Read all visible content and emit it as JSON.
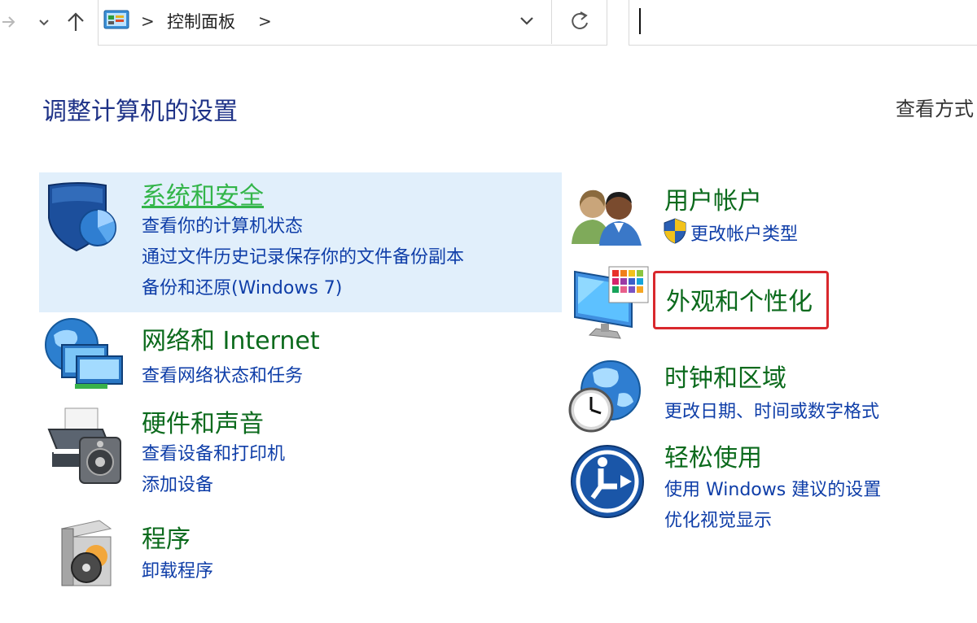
{
  "addressbar": {
    "crumb": "控制面板",
    "sep1": ">",
    "sep2": ">"
  },
  "search": {
    "value": "",
    "placeholder": ""
  },
  "page": {
    "title": "调整计算机的设置",
    "view_by": "查看方式"
  },
  "categories": {
    "system_security": {
      "title": "系统和安全",
      "links": [
        "查看你的计算机状态",
        "通过文件历史记录保存你的文件备份副本",
        "备份和还原(Windows 7)"
      ]
    },
    "network": {
      "title": "网络和 Internet",
      "links": [
        "查看网络状态和任务"
      ]
    },
    "hardware": {
      "title": "硬件和声音",
      "links": [
        "查看设备和打印机",
        "添加设备"
      ]
    },
    "programs": {
      "title": "程序",
      "links": [
        "卸载程序"
      ]
    },
    "user_accounts": {
      "title": "用户帐户",
      "links": [
        "更改帐户类型"
      ]
    },
    "appearance": {
      "title": "外观和个性化",
      "links": []
    },
    "clock_region": {
      "title": "时钟和区域",
      "links": [
        "更改日期、时间或数字格式"
      ]
    },
    "ease_of_access": {
      "title": "轻松使用",
      "links": [
        "使用 Windows 建议的设置",
        "优化视觉显示"
      ]
    }
  },
  "colors": {
    "title_green": "#0b6a1c",
    "hover_green": "#33b54a",
    "link_blue": "#0f3ea8",
    "highlight": "#e1effb",
    "annotation_red": "#d9282d"
  }
}
